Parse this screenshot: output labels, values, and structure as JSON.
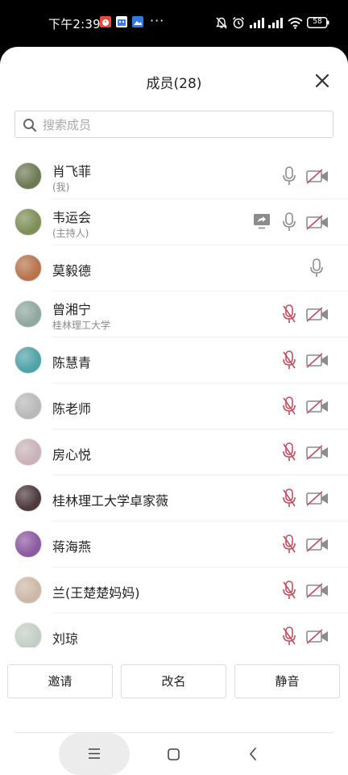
{
  "status_bar": {
    "time": "下午2:39",
    "more": "···",
    "battery": "58"
  },
  "header": {
    "title": "成员(28)"
  },
  "search": {
    "placeholder": "搜索成员"
  },
  "members": [
    {
      "name": "肖飞菲",
      "subtitle": "(我)",
      "mic": "on",
      "video": "off",
      "share": false,
      "avatar_color": "#6e7a55"
    },
    {
      "name": "韦运会",
      "subtitle": "(主持人)",
      "mic": "on",
      "video": "off",
      "share": true,
      "avatar_color": "#7e8f58"
    },
    {
      "name": "莫毅德",
      "subtitle": "",
      "mic": "on",
      "video": "none",
      "share": false,
      "avatar_color": "#b8734c"
    },
    {
      "name": "曾湘宁",
      "subtitle": "桂林理工大学",
      "mic": "muted",
      "video": "off",
      "share": false,
      "avatar_color": "#8fa8a0"
    },
    {
      "name": "陈慧青",
      "subtitle": "",
      "mic": "muted",
      "video": "off",
      "share": false,
      "avatar_color": "#4fa3a8"
    },
    {
      "name": "陈老师",
      "subtitle": "",
      "mic": "muted",
      "video": "off",
      "share": false,
      "avatar_color": "#b9b9b9"
    },
    {
      "name": "房心悦",
      "subtitle": "",
      "mic": "muted",
      "video": "off",
      "share": false,
      "avatar_color": "#c9b3b8"
    },
    {
      "name": "桂林理工大学卓家薇",
      "subtitle": "",
      "mic": "muted",
      "video": "off",
      "share": false,
      "avatar_color": "#4e3a3e"
    },
    {
      "name": "蒋海燕",
      "subtitle": "",
      "mic": "muted",
      "video": "off",
      "share": false,
      "avatar_color": "#8c5aa0"
    },
    {
      "name": "兰(王楚楚妈妈)",
      "subtitle": "",
      "mic": "muted",
      "video": "off",
      "share": false,
      "avatar_color": "#cdb8a8"
    },
    {
      "name": "刘琼",
      "subtitle": "",
      "mic": "muted",
      "video": "off",
      "share": false,
      "avatar_color": "#c4cec6"
    }
  ],
  "actions": {
    "invite": "邀请",
    "rename": "改名",
    "mute": "静音"
  },
  "colors": {
    "mic_muted": "#c84d5f",
    "icon_gray": "#8c8c8c",
    "text": "#222222",
    "subtext": "#8a8a8a"
  }
}
